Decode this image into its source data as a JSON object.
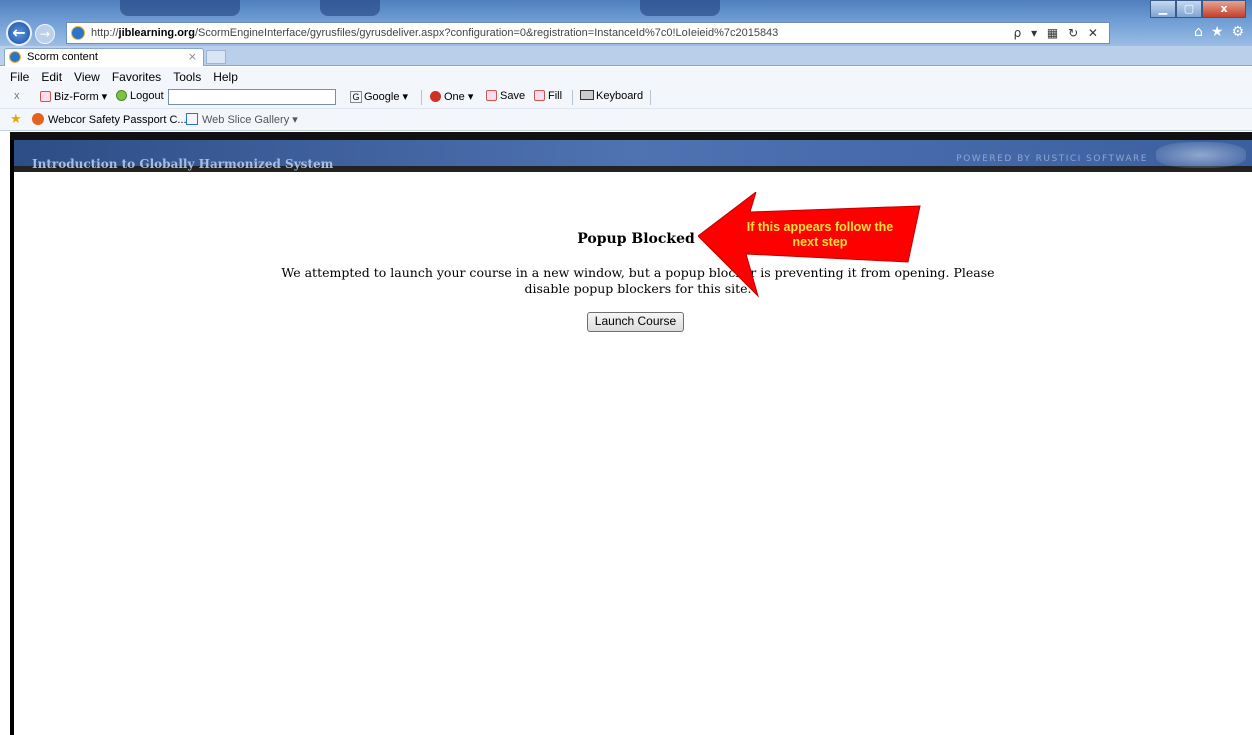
{
  "browser": {
    "url_prefix": "http://",
    "url_domain": "jiblearning.org",
    "url_path": "/ScormEngineInterface/gyrusfiles/gyrusdeliver.aspx?configuration=0&registration=InstanceId%7c0!LoIeieid%7c2015843",
    "address_tools": "ρ ▾ ▦ ↻ ✕",
    "tab_label": "Scorm content",
    "tab_close": "×"
  },
  "window": {
    "min": "▁",
    "max": "▢",
    "close": "x"
  },
  "menu": [
    "File",
    "Edit",
    "View",
    "Favorites",
    "Tools",
    "Help"
  ],
  "toolbar": {
    "close_x": "x",
    "bizform": "Biz-Form ▾",
    "logout": "Logout",
    "google": "Google ▾",
    "one": "One ▾",
    "save": "Save",
    "fill": "Fill",
    "keyboard": "Keyboard"
  },
  "favorites": {
    "item1": "Webcor Safety Passport C...",
    "item2": "Web Slice Gallery ▾"
  },
  "banner": {
    "title": "Introduction to Globally Harmonized System",
    "powered": "POWERED BY RUSTICI SOFTWARE"
  },
  "page": {
    "heading": "Popup Blocked",
    "message": "We attempted to launch your course in a new window, but a popup blocker is preventing it from opening. Please disable popup blockers for this site.",
    "button": "Launch Course"
  },
  "annotation": {
    "text": "If this appears follow the next step",
    "color": "#ff0000"
  }
}
